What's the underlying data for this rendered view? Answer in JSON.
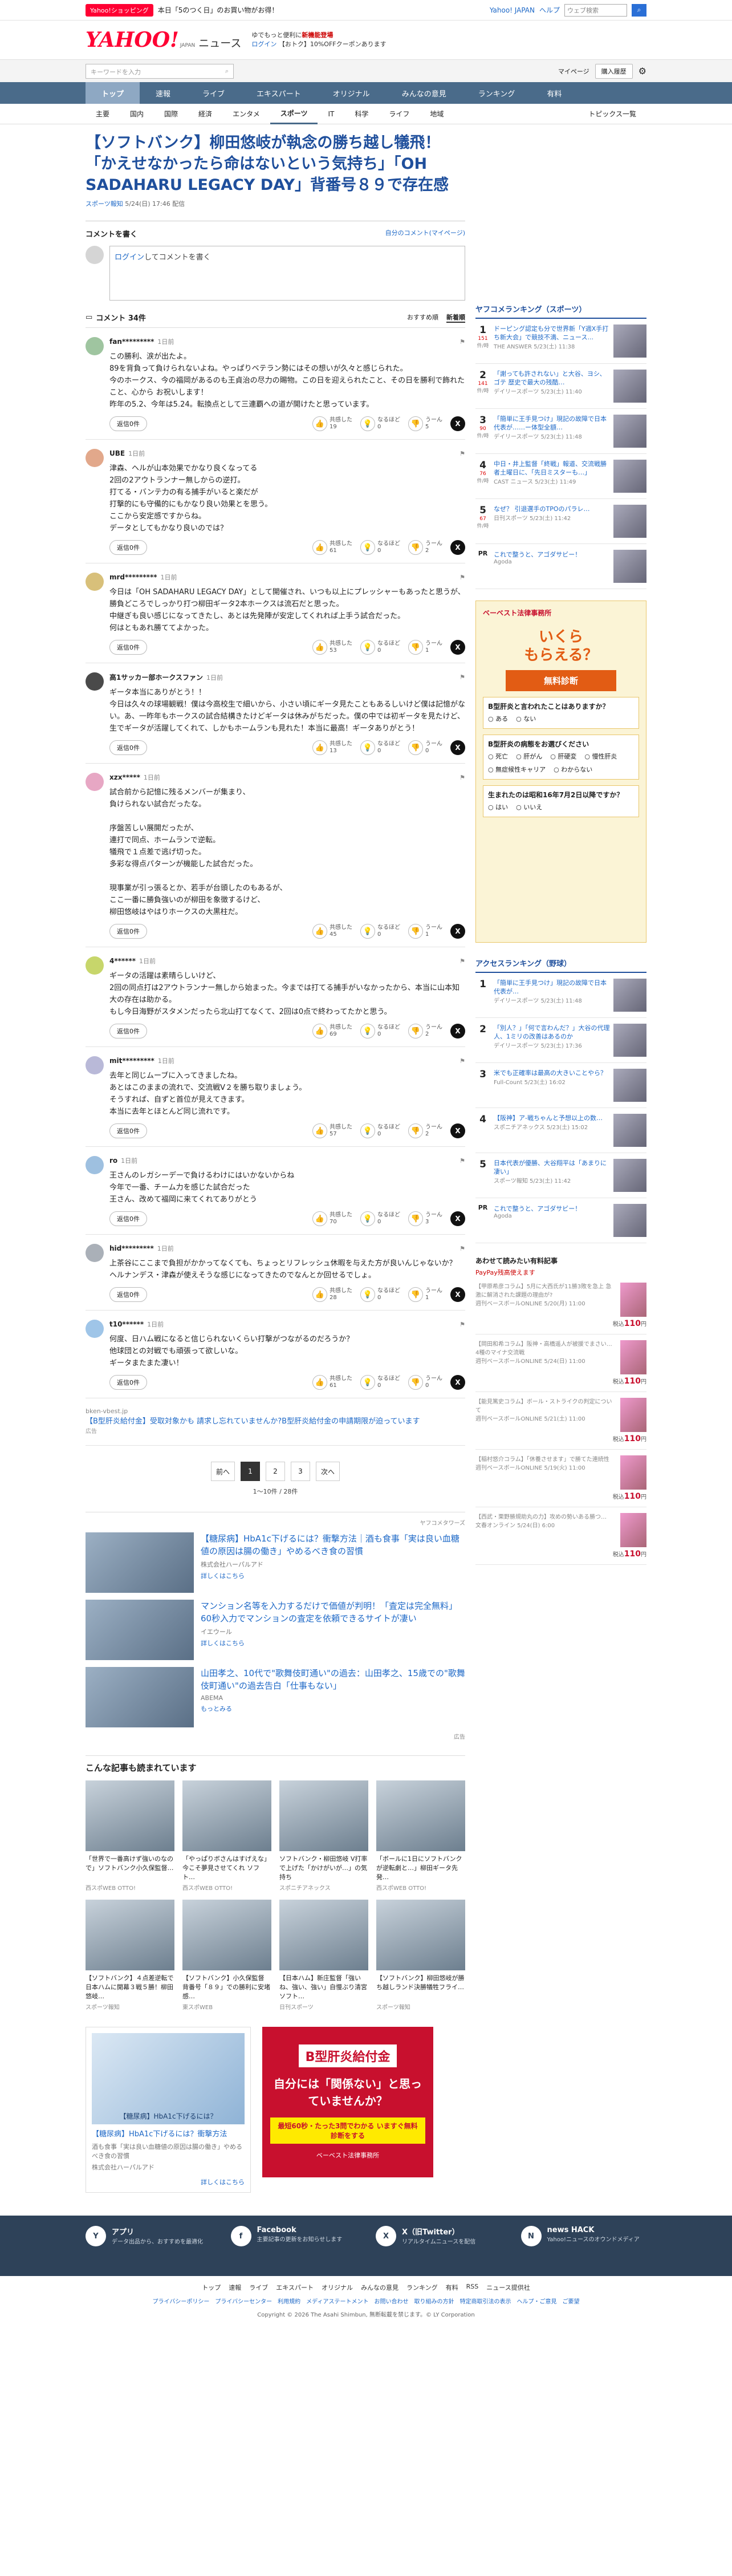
{
  "topstrip": {
    "badge": "Yahoo!ショッピング",
    "text": "本日「5のつく日」のお買い物がお得！",
    "right_link": "Yahoo! JAPAN",
    "help": "ヘルプ",
    "search_placeholder": "ウェブ検索",
    "login_label": "ログイン",
    "points": "0 円相当 40 pt"
  },
  "header": {
    "logo": "YAHOO!",
    "logo_sub": "JAPAN",
    "news": "ニュース",
    "promo1": "ゆでもっと便利に",
    "promo1b": "新機能登場",
    "promo2": "ログイン",
    "promo2b": "【おトク】10%OFFクーポンあります"
  },
  "utilbar": {
    "search_placeholder": "キーワードを入力",
    "mypage": "マイページ",
    "subscribe": "購入履歴"
  },
  "gnav": [
    "トップ",
    "速報",
    "ライブ",
    "エキスパート",
    "オリジナル",
    "みんなの意見",
    "ランキング",
    "有料"
  ],
  "snav": [
    "主要",
    "国内",
    "国際",
    "経済",
    "エンタメ",
    "スポーツ",
    "IT",
    "科学",
    "ライフ",
    "地域"
  ],
  "snav_active": "スポーツ",
  "snav_right": "トピックス一覧",
  "article": {
    "title": "【ソフトバンク】柳田悠岐が執念の勝ち越し犠飛！「かえせなかったら命はないという気持ち」「OH SADAHARU LEGACY DAY」背番号８９で存在感",
    "source": "スポーツ報知",
    "time": "5/24(日) 17:46 配信"
  },
  "comment_write": {
    "heading": "コメントを書く",
    "my_comments": "自分のコメント(マイページ)",
    "login_text": "ログイン",
    "placeholder_rest": "してコメントを書く"
  },
  "comments_header": {
    "count": "コメント 34件",
    "sort1": "おすすめ順",
    "sort2": "新着順"
  },
  "comments": [
    {
      "user": "fan*********",
      "time": "1日前",
      "text": "この勝利、涙が出たよ。\n89を背負って負けられないよね。やっぱりベテラン勢にはその想いが久々と感じられた。\n今のホークス、今の福岡があるのも王貞治の尽力の賜物。この日を迎えられたこと、その日を勝利で飾れたこと、心から お祝いします！\n昨年の5.2、今年は5.24。転換点として三連覇への道が開けたと思っています。",
      "replies": "返信0件",
      "good": "共感した\n19",
      "ok": "なるほど\n0",
      "bad": "うーん\n5",
      "color": "#9fc5a0"
    },
    {
      "user": "UBE",
      "time": "1日前",
      "text": "津森、ヘルが山本効果でかなり良くなってる\n2回の2アウトランナー無しからの逆打。\n打てる・バンテ力の有る捕手がいると楽だが\n打撃的にも守備的にもかなり良い効果とを思う。\nここから安定感ですからね。\nデータとしてもかなり良いのでは？",
      "replies": "返信0件",
      "good": "共感した\n61",
      "ok": "なるほど\n0",
      "bad": "うーん\n2",
      "color": "#e2a88b"
    },
    {
      "user": "mrd*********",
      "time": "1日前",
      "text": "今日は「OH SADAHARU LEGACY DAY」として開催され、いつも以上にプレッシャーもあったと思うが、勝負どころでしっかり打つ柳田ギータ2本ホークスは流石だと思った。\n中継ぎも良い感じになってきたし、あとは先発陣が安定してくれれば上手う試合だった。\n何はともあれ勝ててよかった。",
      "replies": "返信0件",
      "good": "共感した\n53",
      "ok": "なるほど\n0",
      "bad": "うーん\n1",
      "color": "#d8c07a"
    },
    {
      "user": "高1サッカー部ホークスファン",
      "time": "1日前",
      "text": "ギータ本当にありがとう！！\n今日は久々の球場観戦！僕は今高校生で細いから、小さい頃にギータ見たこともあるしいけど僕は記憶がない。あ、一昨年もホークスの試合結構きたけどギータは休みがちだった。僕の中では初ギータを見たけど、生でギータが活躍してくれて、しかもホームランも見れた！本当に最高！ギータありがとう！",
      "replies": "返信0件",
      "good": "共感した\n13",
      "ok": "なるほど\n0",
      "bad": "うーん\n0",
      "color": "#4a4a4a"
    },
    {
      "user": "xzx*****",
      "time": "1日前",
      "text": "試合前から記憶に残るメンバーが集まり、\n負けられない試合だったな。\n\n序盤苦しい展開だったが、\n連打で同点、ホームランで逆転。\n犠飛で１点差で逃げ切った。\n多彩な得点パターンが機能した試合だった。\n\n現事業が引っ張るとか、若手が台頭したのもあるが、\nここ一番に勝負強いのが柳田を象徴するけど、\n柳田悠岐はやはりホークスの大黒柱だ。",
      "replies": "返信0件",
      "good": "共感した\n45",
      "ok": "なるほど\n0",
      "bad": "うーん\n1",
      "color": "#e7a7c4"
    },
    {
      "user": "4******",
      "time": "1日前",
      "text": "ギータの活躍は素晴らしいけど、\n2回の同点打は2アウトランナー無しから始まった。今までは打てる捕手がいなかったから、本当に山本知大の存在は助かる。\nもし今日海野がスタメンだったら北山打てなくて、2回は0点で終わってたかと思う。",
      "replies": "返信0件",
      "good": "共感した\n69",
      "ok": "なるほど\n0",
      "bad": "うーん\n2",
      "color": "#c7d66b"
    },
    {
      "user": "mit*********",
      "time": "1日前",
      "text": "去年と同じムーブに入ってきましたね。\nあとはこのままの流れで、交流戦V２を勝ち取りましょう。\nそうすれば、自ずと首位が見えてきます。\n本当に去年とほとんど同じ流れです。",
      "replies": "返信0件",
      "good": "共感した\n57",
      "ok": "なるほど\n0",
      "bad": "うーん\n2",
      "color": "#b9b9d8"
    },
    {
      "user": "ro",
      "time": "1日前",
      "text": "王さんのレガシーデーで負けるわけにはいかないからね\n今年で一番、チーム力を感じた試合だった\n王さん、改めて福岡に来てくれてありがとう",
      "replies": "返信0件",
      "good": "共感した\n70",
      "ok": "なるほど\n0",
      "bad": "うーん\n3",
      "color": "#9ec0e0"
    },
    {
      "user": "hid*********",
      "time": "1日前",
      "text": "上茶谷にここまで負担がかかってなくても、ちょっとリフレッシュ休暇を与えた方が良いんじゃないか？\nヘルナンデス・津森が使えそうな感じになってきたのでなんとか回せるでしょ。",
      "replies": "返信0件",
      "good": "共感した\n28",
      "ok": "なるほど\n0",
      "bad": "うーん\n1",
      "color": "#aab0b8"
    },
    {
      "user": "t10******",
      "time": "1日前",
      "text": "何度、日ハム戦になると信じられないくらい打撃がつながるのだろうか？\n他球団との対戦でも頑張って欲しいな。\nギータまたまた凄い！",
      "replies": "返信0件",
      "good": "共感した\n61",
      "ok": "なるほど\n0",
      "bad": "うーん\n0",
      "color": "#9fc5e8"
    }
  ],
  "inline_ad": {
    "source": "bken-vbest.jp",
    "text": "【B型肝炎給付金】受取対象かも 請求し忘れていませんか?B型肝炎給付金の申請期限が迫っています",
    "pr": "広告"
  },
  "pager": {
    "prev": "前へ",
    "pages": [
      "1",
      "2",
      "3"
    ],
    "next": "次へ",
    "count": "1〜10件 / 28件"
  },
  "ads": {
    "tag": "ヤフコメタワーズ",
    "items": [
      {
        "h": "【糖尿病】HbA1c下げるには？衝撃方法｜酒も食事「実は良い血糖値の原因は腸の働き」やめるべき食の習慣",
        "s": "株式会社ハーパルアド",
        "m": "詳しくはこちら"
      },
      {
        "h": "マンション名等を入力するだけで価値が判明！「査定は完全無料」60秒入力でマンションの査定を依頼できるサイトが凄い",
        "s": "イエウール",
        "m": "詳しくはこちら"
      },
      {
        "h": "山田孝之、10代で\"歌舞伎町通い\"の過去：山田孝之、15歳での\"歌舞伎町通い\"の過去告白「仕事もない」",
        "s": "ABEMA",
        "m": "もっとみる"
      }
    ],
    "foot": "広告"
  },
  "related": {
    "heading": "こんな記事も読まれています",
    "items": [
      {
        "t": "「世界で一番高けず強いのなので」ソフトバンク小久保監督…",
        "s": "西スポWEB OTTO!"
      },
      {
        "t": "「やっぱりボさんはすげえな」今こそ夢見させてくれ ソフト…",
        "s": "西スポWEB OTTO!"
      },
      {
        "t": "ソフトバンク・柳田悠岐 V打率で上げた「かけがいが…」の気持ち",
        "s": "スポニチアネックス"
      },
      {
        "t": "「ボールに1日にソフトバンクが逆転劇と…」柳田ギータ先発…",
        "s": "西スポWEB OTTO!"
      },
      {
        "t": "【ソフトバンク】４点差逆転で日本ハムに開幕３戦５勝！柳田悠岐…",
        "s": "スポーツ報知"
      },
      {
        "t": "【ソフトバンク】小久保監督 背番号「８９」での勝利に安堵感…",
        "s": "東スポWEB"
      },
      {
        "t": "【日本ハム】新庄監督「強いね、強い、強い」自慢ぶり清宮ソフト…",
        "s": "日刊スポーツ"
      },
      {
        "t": "【ソフトバンク】柳田悠岐が勝ち越しランド決勝犠牲フライ…",
        "s": "スポーツ報知"
      }
    ]
  },
  "bottom_ad1": {
    "img": "【糖尿病】HbA1c下げるには？",
    "t": "【糖尿病】HbA1c下げるには？衝撃方法",
    "s": "酒も食事「実は良い血糖値の原因は腸の働き」やめるべき食の習慣",
    "src": "株式会社ハーパルアド",
    "d": "詳しくはこちら"
  },
  "bottom_ad2": {
    "a": "B型肝炎給付金",
    "b": "自分には「関係ない」と思っていませんか？",
    "c": "最短60秒・たった3問でわかる いますぐ無料診断をする",
    "d": "ベーベスト法律事務所"
  },
  "sidebar": {
    "rank_heading": "ヤフコメランキング（スポーツ）",
    "rank": [
      {
        "n": "1",
        "c": "151",
        "u": "件/時",
        "t": "ドーピング認定も分で世界新「Y週X手打ち新大会」で競技不満、ニュース...",
        "s": "THE ANSWER 5/23(土) 11:38"
      },
      {
        "n": "2",
        "c": "141",
        "u": "件/時",
        "t": "「謝っても許されない」と大谷、ヨシ、ゴテ 歴史で最大の残酷…",
        "s": "デイリースポーツ 5/23(土) 11:40"
      },
      {
        "n": "3",
        "c": "90",
        "u": "件/時",
        "t": "「簡単に王手見つけ」現記の故障で日本代表が……ー体型全額…",
        "s": "デイリースポーツ 5/23(土) 11:48"
      },
      {
        "n": "4",
        "c": "76",
        "u": "件/時",
        "t": "中日・井上監督「終戦」報道、交流戦勝者土曜日に、「先日ミスターも…」",
        "s": "CAST ニュース 5/23(土) 11:49"
      },
      {
        "n": "5",
        "c": "67",
        "u": "件/時",
        "t": "なぜ？ 引退選手のTPOのパラレ…",
        "s": "日刊スポーツ 5/23(土) 11:42"
      }
    ],
    "pr1": {
      "pr": "PR",
      "t": "これで整うと、アゴダサビー！",
      "s": "Agoda"
    },
    "sad": {
      "logo": "ベーベスト法律事務所",
      "big": "いくら\nもらえる？",
      "cta": "無料診断",
      "q1": "B型肝炎と言われたことはありますか？",
      "q1o": [
        "ある",
        "ない"
      ],
      "q2": "B型肝炎の病態をお選びください",
      "q2o": [
        "死亡",
        "肝がん",
        "肝硬変",
        "慢性肝炎",
        "無症候性キャリア",
        "わからない"
      ],
      "q3": "生まれたのは昭和16年7月2日以降ですか？",
      "q3o": [
        "はい",
        "いいえ"
      ]
    },
    "access_heading": "アクセスランキング（野球）",
    "access": [
      {
        "n": "1",
        "t": "「簡単に王手見つけ」現記の故障で日本代表が…",
        "s": "デイリースポーツ 5/23(土) 11:48"
      },
      {
        "n": "2",
        "t": "「別人？」「何で言わんだ？」大谷の代理人、1ミリの改善はあるのか",
        "s": "デイリースポーツ 5/23(土) 17:36"
      },
      {
        "n": "3",
        "t": "米でも正確率は最高の大きいことやら？",
        "s": "Full-Count 5/23(土) 16:02"
      },
      {
        "n": "4",
        "t": "【阪神】ア-戦ちゃんと予想以上の数…",
        "s": "スポニチアネックス 5/23(土) 15:02"
      },
      {
        "n": "5",
        "t": "日本代表が優勝、大谷翔平は「あまりに凄い」",
        "s": "スポーツ報知 5/23(土) 11:42"
      }
    ],
    "pr2": {
      "pr": "PR",
      "t": "これで整うと、アゴダサビー！",
      "s": "Agoda"
    },
    "books_heading": "あわせて読みたい有料記事",
    "paypay": "PayPay残高使えます",
    "books": [
      {
        "t": "【甲原希彦コラム】5月に大西氏が11勝3敗を急上 急激に解消された課題の理由が?",
        "s": "週刊ベースボールONLINE 5/20(月) 11:00",
        "p": "110"
      },
      {
        "t": "【岡田和希コラム】阪神・高橋遥人が被援でまさい…4種のマイナ交流戦",
        "s": "週刊ベースボールONLINE 5/24(日) 11:00",
        "p": "110"
      },
      {
        "t": "【能見篤史コラム】ボール・ストライクの判定について",
        "s": "週刊ベースボールONLINE 5/21(土) 11:00",
        "p": "110"
      },
      {
        "t": "【稲村悠介コラム】「休養させます」で勝てた連続性",
        "s": "週刊ベースボールONLINE 5/19(火) 11:00",
        "p": "110"
      },
      {
        "t": "【西武・栗野勝規助丸の力】攻めの勢いある勝つ…",
        "s": "文春オンライン 5/24(日) 6:00",
        "p": "110"
      }
    ],
    "yen_label": "税込",
    "yen_unit": "円"
  },
  "footer": {
    "items": [
      {
        "icon": "Y",
        "t": "アプリ",
        "s": "データ出品から、おすすめを最適化"
      },
      {
        "icon": "f",
        "t": "Facebook",
        "s": "主要記事の更新をお知らせします"
      },
      {
        "icon": "X",
        "t": "X（旧Twitter）",
        "s": "リアルタイムニュースを配信"
      },
      {
        "icon": "N",
        "t": "news HACK",
        "s": "Yahoo!ニュースのオウンドメディア"
      }
    ],
    "links": [
      "トップ",
      "速報",
      "ライブ",
      "エキスパート",
      "オリジナル",
      "みんなの意見",
      "ランキング",
      "有料",
      "RSS",
      "ニュース提供社"
    ],
    "links2": [
      "プライバシーポリシー",
      "プライバシーセンター",
      "利用規約",
      "メディアステートメント",
      "お問い合わせ",
      "取り組みの方針",
      "特定商取引法の表示",
      "ヘルプ・ご意見",
      "ご要望"
    ],
    "copy": "Copyright © 2026 The Asahi Shimbun, 無断転載を禁じます。© LY Corporation"
  }
}
